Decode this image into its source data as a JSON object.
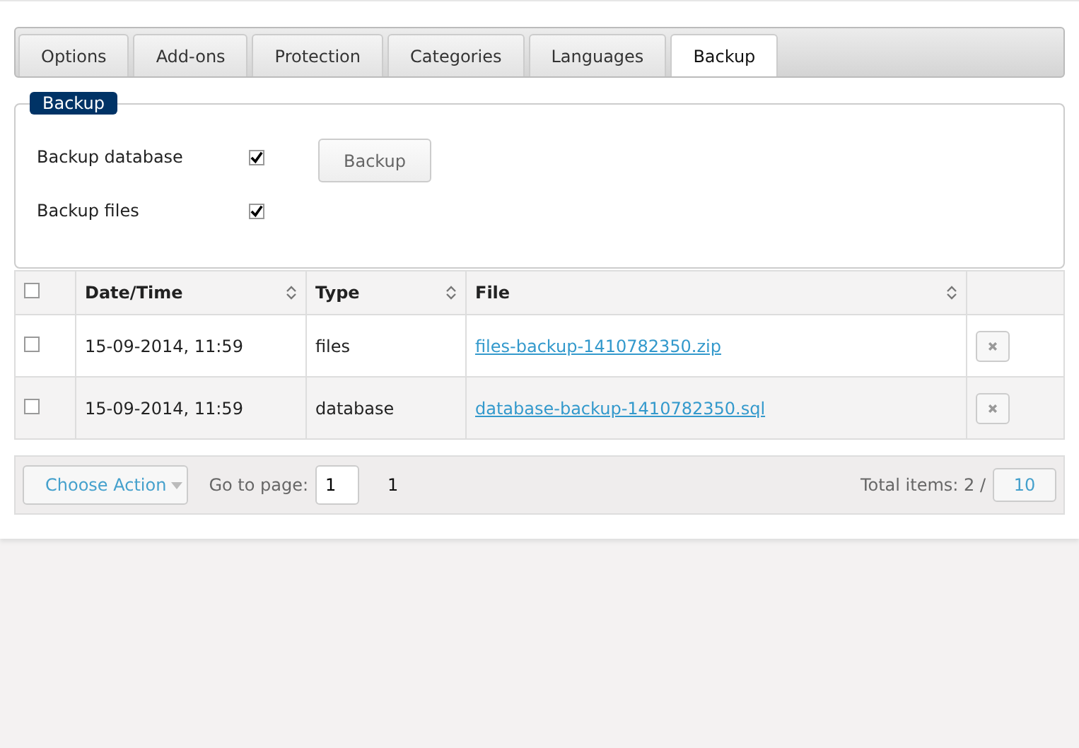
{
  "tabs": [
    {
      "label": "Options",
      "selected": false
    },
    {
      "label": "Add-ons",
      "selected": false
    },
    {
      "label": "Protection",
      "selected": false
    },
    {
      "label": "Categories",
      "selected": false
    },
    {
      "label": "Languages",
      "selected": false
    },
    {
      "label": "Backup",
      "selected": true
    }
  ],
  "backup_panel": {
    "legend": "Backup",
    "options": [
      {
        "label": "Backup database",
        "checked": true
      },
      {
        "label": "Backup files",
        "checked": true
      }
    ],
    "button": "Backup"
  },
  "table": {
    "select_all_checked": false,
    "columns": [
      "Date/Time",
      "Type",
      "File"
    ],
    "rows": [
      {
        "checked": false,
        "date": "15-09-2014, 11:59",
        "type": "files",
        "file": "files-backup-1410782350.zip"
      },
      {
        "checked": false,
        "date": "15-09-2014, 11:59",
        "type": "database",
        "file": "database-backup-1410782350.sql"
      }
    ]
  },
  "footer": {
    "action": "Choose Action",
    "goto_label": "Go to page:",
    "goto_value": "1",
    "pages": [
      "1"
    ],
    "total": "Total items: 2 /",
    "per_page": "10"
  }
}
